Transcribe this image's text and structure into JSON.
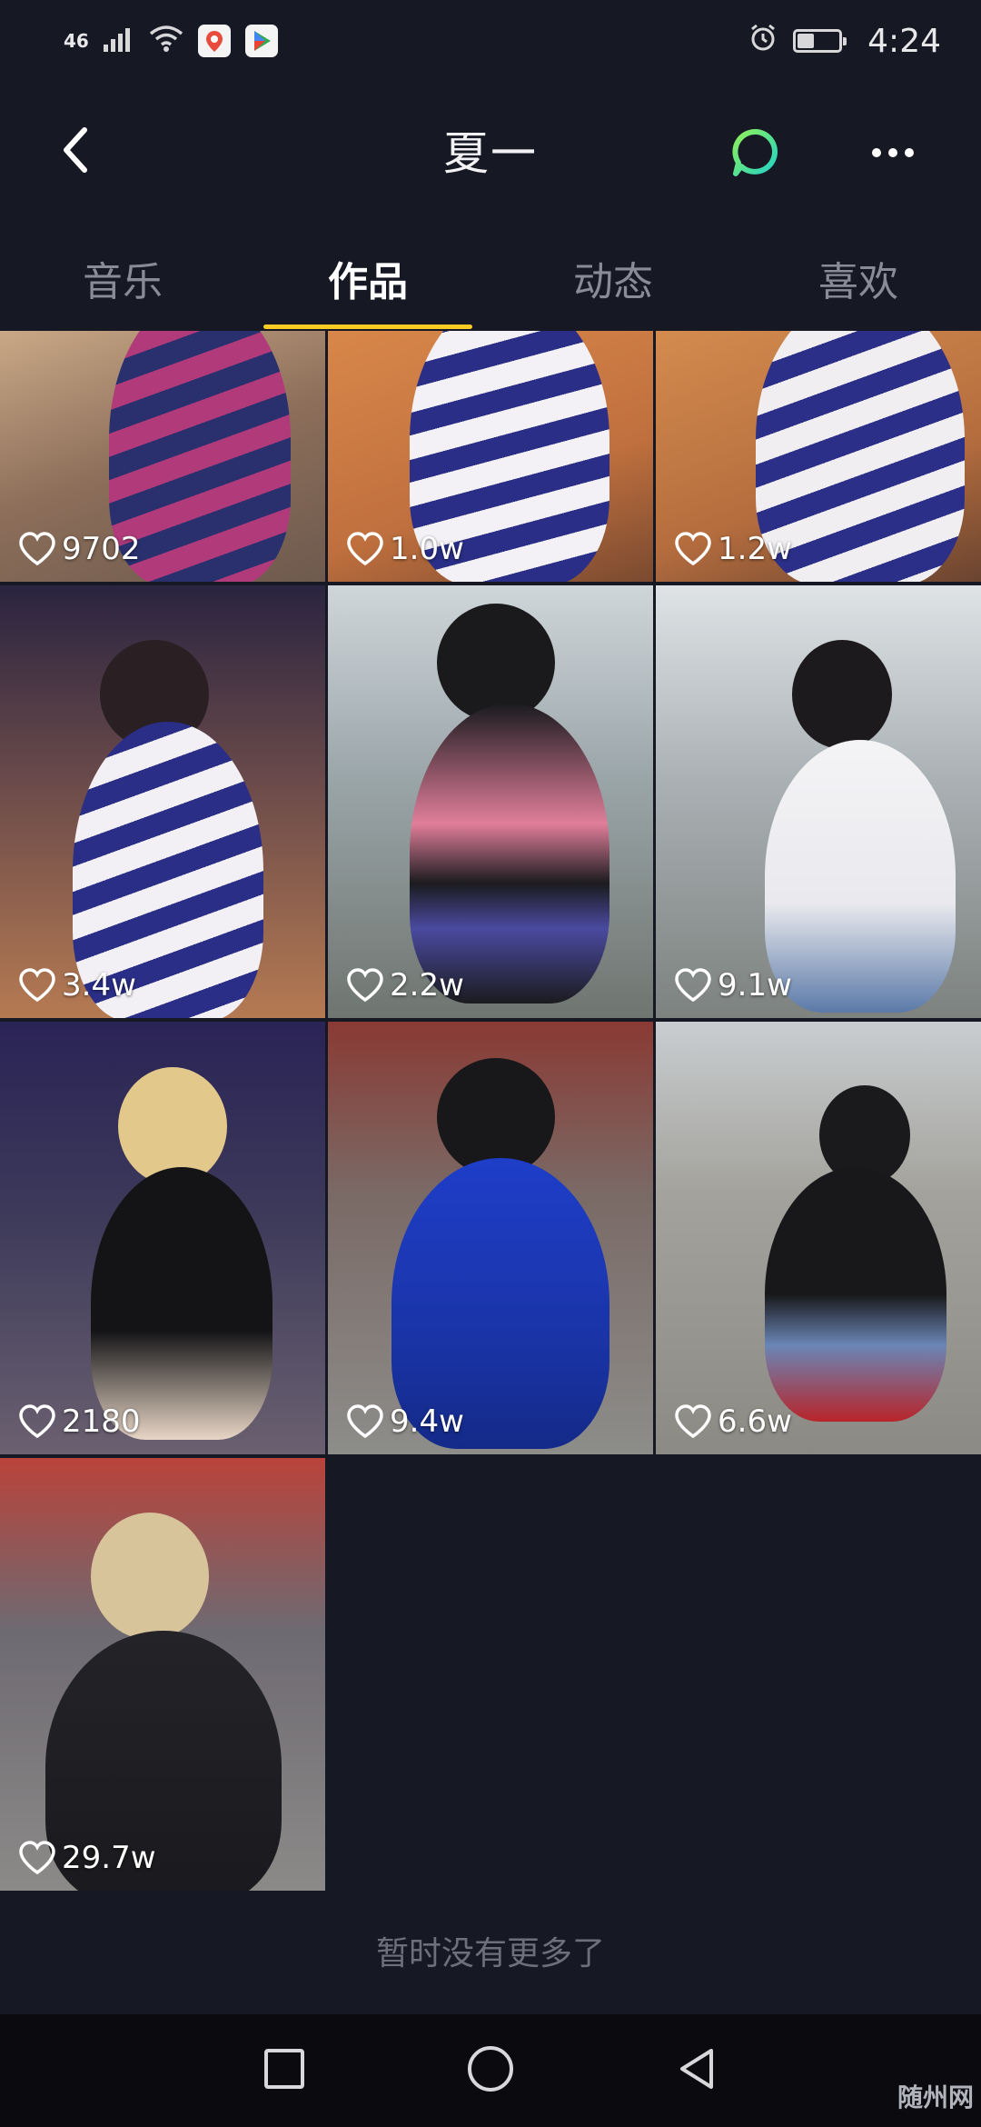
{
  "status": {
    "network": "46",
    "time": "4:24",
    "battery_level": 0.4
  },
  "header": {
    "title": "夏一"
  },
  "tabs": [
    {
      "label": "音乐"
    },
    {
      "label": "作品"
    },
    {
      "label": "动态"
    },
    {
      "label": "喜欢"
    }
  ],
  "videos": [
    {
      "likes": "9702"
    },
    {
      "likes": "1.0w"
    },
    {
      "likes": "1.2w"
    },
    {
      "likes": "3.4w"
    },
    {
      "likes": "2.2w"
    },
    {
      "likes": "9.1w"
    },
    {
      "likes": "2180"
    },
    {
      "likes": "9.4w"
    },
    {
      "likes": "6.6w"
    },
    {
      "likes": "29.7w"
    }
  ],
  "footer": {
    "no_more": "暂时没有更多了"
  },
  "watermark": "随州网",
  "colors": {
    "background": "#161824",
    "tab_indicator": "#f8cc22",
    "chat_icon": "#29e0a8"
  }
}
